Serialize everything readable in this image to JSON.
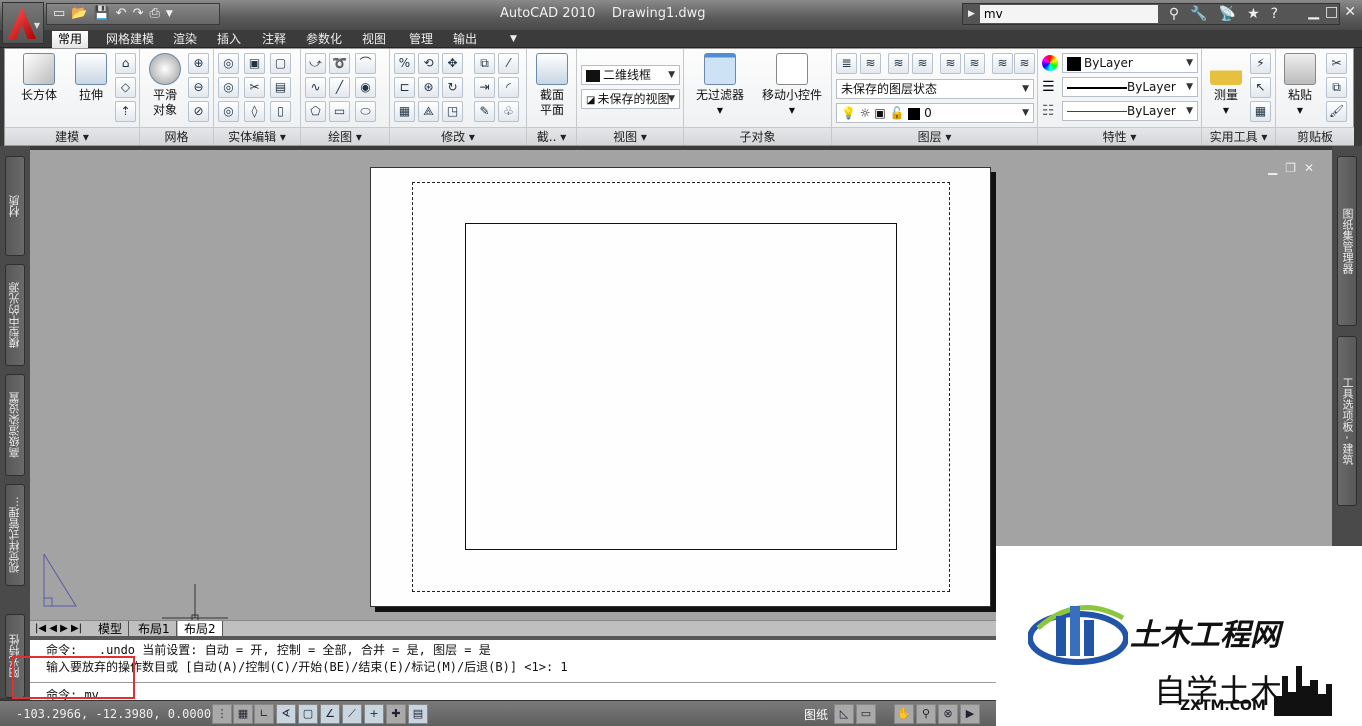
{
  "titlebar": {
    "app_name": "AutoCAD 2010",
    "document": "Drawing1.dwg",
    "quick_access": [
      "new-icon",
      "open-icon",
      "save-icon",
      "undo-icon",
      "redo-icon",
      "print-icon",
      "customize-dropdown-icon"
    ],
    "search": {
      "value": "mv"
    }
  },
  "tabs": [
    {
      "label": "常用",
      "active": true
    },
    {
      "label": "网格建模"
    },
    {
      "label": "渲染"
    },
    {
      "label": "插入"
    },
    {
      "label": "注释"
    },
    {
      "label": "参数化"
    },
    {
      "label": "视图"
    },
    {
      "label": "管理"
    },
    {
      "label": "输出"
    }
  ],
  "ribbon": {
    "panels": {
      "modeling": {
        "label": "建模 ▾",
        "box": "长方体",
        "extrude": "拉伸"
      },
      "mesh": {
        "label": "网格",
        "smooth_1": "平滑",
        "smooth_2": "对象"
      },
      "solid_edit": {
        "label": "实体编辑 ▾"
      },
      "draw": {
        "label": "绘图 ▾"
      },
      "modify": {
        "label": "修改 ▾"
      },
      "section": {
        "label": "截.. ▾",
        "plane_1": "截面",
        "plane_2": "平面"
      },
      "view": {
        "label": "视图 ▾",
        "visual_style": "二维线框",
        "named_view": "未保存的视图"
      },
      "subobject": {
        "label": "子对象",
        "filter": "无过滤器",
        "gizmo": "移动小控件"
      },
      "layers": {
        "label": "图层 ▾",
        "layer_state": "未保存的图层状态",
        "current_layer": "0"
      },
      "properties": {
        "label": "特性 ▾",
        "color": "ByLayer",
        "lineweight": "ByLayer",
        "linetype": "ByLayer"
      },
      "utilities": {
        "label": "实用工具 ▾",
        "measure": "测量"
      },
      "clipboard": {
        "label": "剪贴板",
        "paste": "粘贴"
      }
    }
  },
  "left_palettes": [
    "材质",
    "模型中的光源",
    "高级渲染设置",
    "视觉样式管理...",
    "阳光特性"
  ],
  "right_palettes": [
    "图纸集管理器",
    "工具选项板 - 建筑"
  ],
  "layout_tabs": [
    {
      "label": "模型"
    },
    {
      "label": "布局1"
    },
    {
      "label": "布局2",
      "active": true
    }
  ],
  "command_line": {
    "history": [
      "命令:  _.undo 当前设置: 自动 = 开, 控制 = 全部, 合并 = 是, 图层 = 是",
      "输入要放弃的操作数目或 [自动(A)/控制(C)/开始(BE)/结束(E)/标记(M)/后退(B)] <1>: 1"
    ],
    "prompt": "命令: mv"
  },
  "status_bar": {
    "coordinates": "-103.2966, -12.3980, 0.0000",
    "space": "图纸"
  },
  "watermark": {
    "title": "土木工程网",
    "subtitle": "自学土木",
    "url": "ZXTM.COM"
  }
}
